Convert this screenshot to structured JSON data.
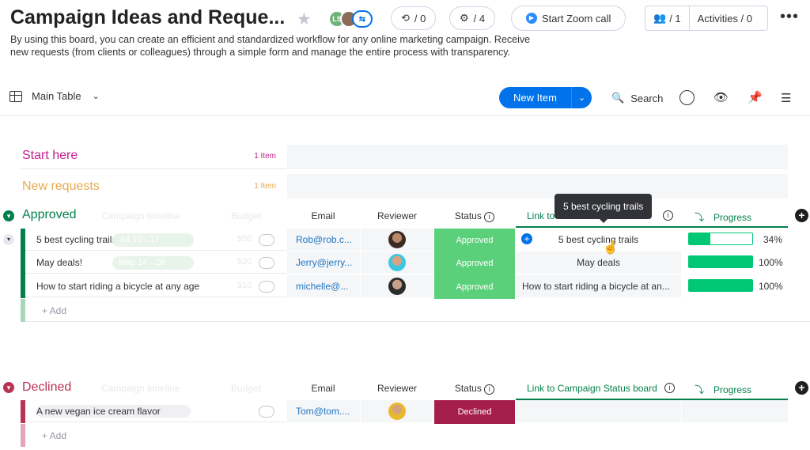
{
  "header": {
    "title": "Campaign Ideas and Reque...",
    "avatars": [
      "LS"
    ],
    "updates_count": "/ 0",
    "automations_count": "/ 4",
    "zoom_label": "Start Zoom call",
    "members_count": "/ 1",
    "activities_label": "Activities / 0",
    "more_icon": "more-icon"
  },
  "description": "By using this board, you can create an efficient and standardized workflow for any online marketing campaign. Receive new requests (from clients or colleagues) through a simple form and manage the entire process with transparency.",
  "toolbar": {
    "view_label": "Main Table",
    "new_item_label": "New Item",
    "search_label": "Search"
  },
  "groups": {
    "start": {
      "name": "Start here",
      "count": "1 Item",
      "color": "#c51e8c"
    },
    "new": {
      "name": "New requests",
      "count": "1 Item",
      "color": "#e7a94f"
    },
    "approved": {
      "name": "Approved",
      "color": "#037f4c",
      "ghost_cols": [
        "Campaign timeline",
        "Budget"
      ],
      "columns": {
        "email": "Email",
        "reviewer": "Reviewer",
        "status": "Status",
        "link": "Link to",
        "progress": "Progress"
      },
      "rows": [
        {
          "name": "5 best cycling trails",
          "timeline": "Jul 10 - 17",
          "budget": "$50",
          "email": "Rob@rob.c...",
          "status": "Approved",
          "link": "5 best cycling trails",
          "progress": "34%",
          "progress_value": 34
        },
        {
          "name": "May deals!",
          "timeline": "May 14 - 29",
          "budget": "$20",
          "email": "Jerry@jerry...",
          "status": "Approved",
          "link": "May deals",
          "progress": "100%",
          "progress_value": 100
        },
        {
          "name": "How to start riding a bicycle at any age",
          "timeline": "",
          "budget": "$10",
          "email": "michelle@...",
          "status": "Approved",
          "link": "How to start riding a bicycle at an...",
          "progress": "100%",
          "progress_value": 100
        }
      ],
      "add_label": "+ Add"
    },
    "declined": {
      "name": "Declined",
      "color": "#bb3354",
      "ghost_cols": [
        "Campaign timeline",
        "Budget"
      ],
      "columns": {
        "email": "Email",
        "reviewer": "Reviewer",
        "status": "Status",
        "link": "Link to Campaign Status board",
        "progress": "Progress"
      },
      "rows": [
        {
          "name": "A new vegan ice cream flavor",
          "email": "Tom@tom....",
          "status": "Declined"
        }
      ],
      "add_label": "+ Add"
    }
  },
  "tooltip": "5 best cycling trails",
  "colors": {
    "accent": "#0073ea",
    "approved": "#5bd07b",
    "declined": "#a51d4a",
    "progress": "#00c875"
  }
}
